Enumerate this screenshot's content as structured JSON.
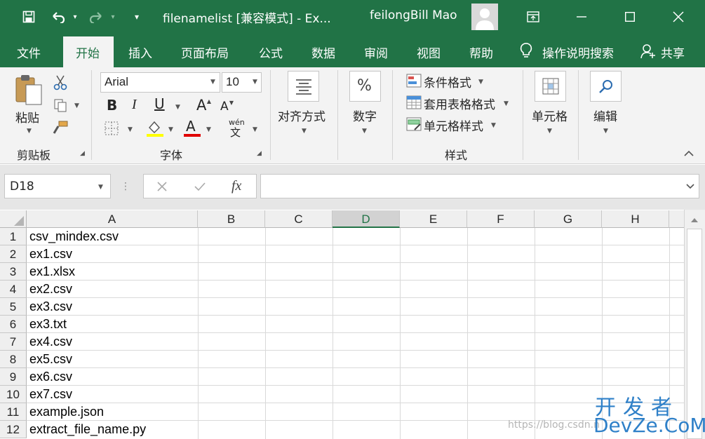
{
  "colors": {
    "accent": "#217346",
    "ribbon_bg": "#f3f3f3",
    "font_red": "#e00000",
    "highlight_yellow": "#ffff00",
    "watermark_blue": "#2f80c8"
  },
  "titlebar": {
    "title": "filenamelist  [兼容模式]  -  Ex...",
    "user": "feilongBill Mao",
    "icons": [
      "save-icon",
      "undo-icon",
      "redo-icon",
      "customize-qat-icon",
      "ribbon-display-icon",
      "minimize-icon",
      "maximize-icon",
      "close-icon"
    ]
  },
  "tabs": [
    "文件",
    "开始",
    "插入",
    "页面布局",
    "公式",
    "数据",
    "审阅",
    "视图",
    "帮助"
  ],
  "active_tab": "开始",
  "tell_me": "操作说明搜索",
  "share": "共享",
  "ribbon": {
    "clipboard": {
      "paste": "粘贴",
      "label": "剪贴板"
    },
    "font": {
      "name": "Arial",
      "size": "10",
      "label": "字体",
      "bold": "B",
      "italic": "I",
      "underline": "U",
      "grow": "A",
      "shrink": "A",
      "border": "",
      "fill": "",
      "color": "A",
      "phonetic_top": "wén",
      "phonetic_bottom": "文"
    },
    "alignment": {
      "label": "对齐方式"
    },
    "number": {
      "label": "数字",
      "symbol": "%"
    },
    "styles": {
      "conditional": "条件格式",
      "table": "套用表格格式",
      "cell_styles": "单元格样式",
      "label": "样式"
    },
    "cells": {
      "label": "单元格"
    },
    "editing": {
      "label": "编辑"
    }
  },
  "formula_bar": {
    "name_box": "D18",
    "fx": "fx",
    "formula": ""
  },
  "sheet": {
    "columns": [
      "A",
      "B",
      "C",
      "D",
      "E",
      "F",
      "G",
      "H"
    ],
    "active_column": "D",
    "rows": [
      {
        "n": "1",
        "a": "csv_mindex.csv"
      },
      {
        "n": "2",
        "a": "ex1.csv"
      },
      {
        "n": "3",
        "a": "ex1.xlsx"
      },
      {
        "n": "4",
        "a": "ex2.csv"
      },
      {
        "n": "5",
        "a": "ex3.csv"
      },
      {
        "n": "6",
        "a": "ex3.txt"
      },
      {
        "n": "7",
        "a": "ex4.csv"
      },
      {
        "n": "8",
        "a": "ex5.csv"
      },
      {
        "n": "9",
        "a": "ex6.csv"
      },
      {
        "n": "10",
        "a": "ex7.csv"
      },
      {
        "n": "11",
        "a": "example.json"
      },
      {
        "n": "12",
        "a": "extract_file_name.py"
      }
    ]
  },
  "watermark": {
    "url": "https://blog.csdn.n",
    "cn": "开发者",
    "en": "DevZe.CoM"
  }
}
